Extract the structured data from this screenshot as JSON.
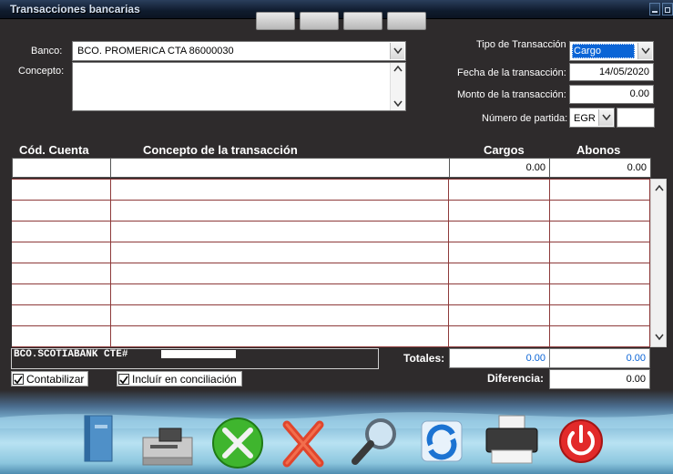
{
  "window": {
    "title": "Transacciones bancarias"
  },
  "form": {
    "banco_label": "Banco:",
    "banco_value": "BCO. PROMERICA CTA 86000030",
    "concepto_label": "Concepto:",
    "concepto_value": "",
    "tipo_label": "Tipo de Transacción",
    "tipo_value": "Cargo",
    "fecha_label": "Fecha de la transacción:",
    "fecha_value": "14/05/2020",
    "monto_label": "Monto de la transacción:",
    "monto_value": "0.00",
    "partida_label": "Número de partida:",
    "partida_type": "EGR",
    "partida_value": ""
  },
  "table": {
    "headers": [
      "Cód. Cuenta",
      "Concepto de la transacción",
      "Cargos",
      "Abonos"
    ],
    "entry": {
      "cuenta": "",
      "concepto": "",
      "cargos": "0.00",
      "abonos": "0.00"
    }
  },
  "footer": {
    "bank_info": "BCO.SCOTIABANK CTE#",
    "contabilizar_label": "Contabilizar",
    "contabilizar_checked": true,
    "conciliacion_label": "Incluír en conciliación",
    "conciliacion_checked": true,
    "totales_label": "Totales:",
    "total_cargos": "0.00",
    "total_abonos": "0.00",
    "diferencia_label": "Diferencia:",
    "diferencia_value": "0.00"
  },
  "toolbar": {
    "icons": [
      "book-icon",
      "tape-drive-icon",
      "tools-icon",
      "delete-x-icon",
      "magnifier-icon",
      "refresh-icon",
      "printer-icon",
      "power-icon"
    ]
  },
  "colors": {
    "background": "#2e2b2c",
    "grid_line": "#8e3a3a",
    "selected": "#0a64d6"
  }
}
